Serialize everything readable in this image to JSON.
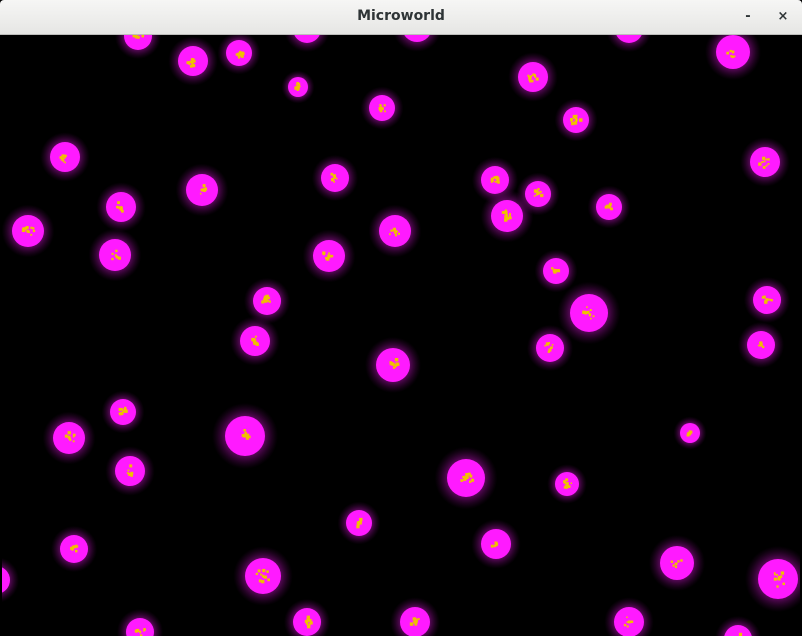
{
  "window": {
    "title": "Microworld",
    "minimize_glyph": "-",
    "close_glyph": "×"
  },
  "colors": {
    "background": "#000000",
    "cell_body": "#ff1aff",
    "cell_halo": "#9a0c9a",
    "nucleus": "#f0c000"
  },
  "icons": {
    "minimize": "minimize-icon",
    "close": "close-icon"
  }
}
